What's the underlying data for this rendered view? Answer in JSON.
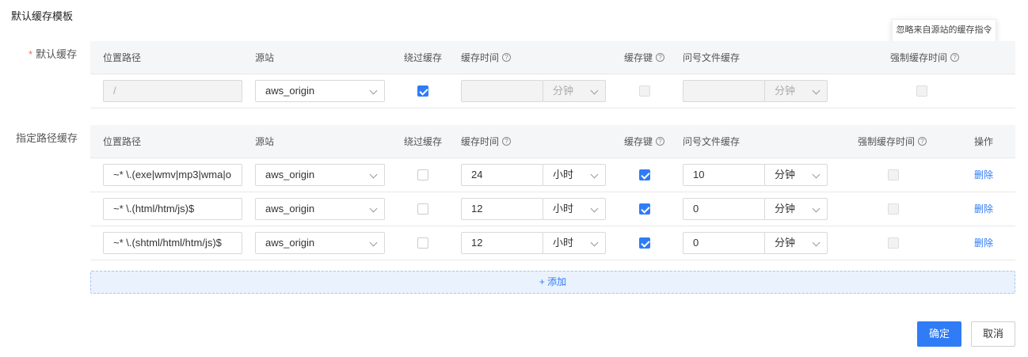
{
  "title": "默认缓存模板",
  "tooltip": "忽略来自源站的缓存指令",
  "default_cache": {
    "label": "默认缓存",
    "headers": {
      "path": "位置路径",
      "origin": "源站",
      "bypass": "绕过缓存",
      "cache_time": "缓存时间",
      "cache_key": "缓存键",
      "query_cache": "问号文件缓存",
      "force_time": "强制缓存时间"
    },
    "row": {
      "path": "/",
      "origin": "aws_origin",
      "bypass_checked": true,
      "cache_time_value": "",
      "cache_time_unit": "分钟",
      "cache_key_checked": false,
      "query_value": "",
      "query_unit": "分钟",
      "force_checked": false
    }
  },
  "path_cache": {
    "label": "指定路径缓存",
    "headers": {
      "path": "位置路径",
      "origin": "源站",
      "bypass": "绕过缓存",
      "cache_time": "缓存时间",
      "cache_key": "缓存键",
      "query_cache": "问号文件缓存",
      "force_time": "强制缓存时间",
      "action": "操作"
    },
    "rows": [
      {
        "path": "~* \\.(exe|wmv|mp3|wma|o",
        "origin": "aws_origin",
        "bypass_checked": false,
        "cache_time_value": "24",
        "cache_time_unit": "小时",
        "cache_key_checked": true,
        "query_value": "10",
        "query_unit": "分钟",
        "force_checked": false,
        "action": "删除"
      },
      {
        "path": "~* \\.(html/htm/js)$",
        "origin": "aws_origin",
        "bypass_checked": false,
        "cache_time_value": "12",
        "cache_time_unit": "小时",
        "cache_key_checked": true,
        "query_value": "0",
        "query_unit": "分钟",
        "force_checked": false,
        "action": "删除"
      },
      {
        "path": "~* \\.(shtml/html/htm/js)$",
        "origin": "aws_origin",
        "bypass_checked": false,
        "cache_time_value": "12",
        "cache_time_unit": "小时",
        "cache_key_checked": true,
        "query_value": "0",
        "query_unit": "分钟",
        "force_checked": false,
        "action": "删除"
      }
    ]
  },
  "add_label": "+ 添加",
  "confirm_label": "确定",
  "cancel_label": "取消",
  "colors": {
    "accent": "#2f7cf6",
    "required": "#f56c6c"
  }
}
